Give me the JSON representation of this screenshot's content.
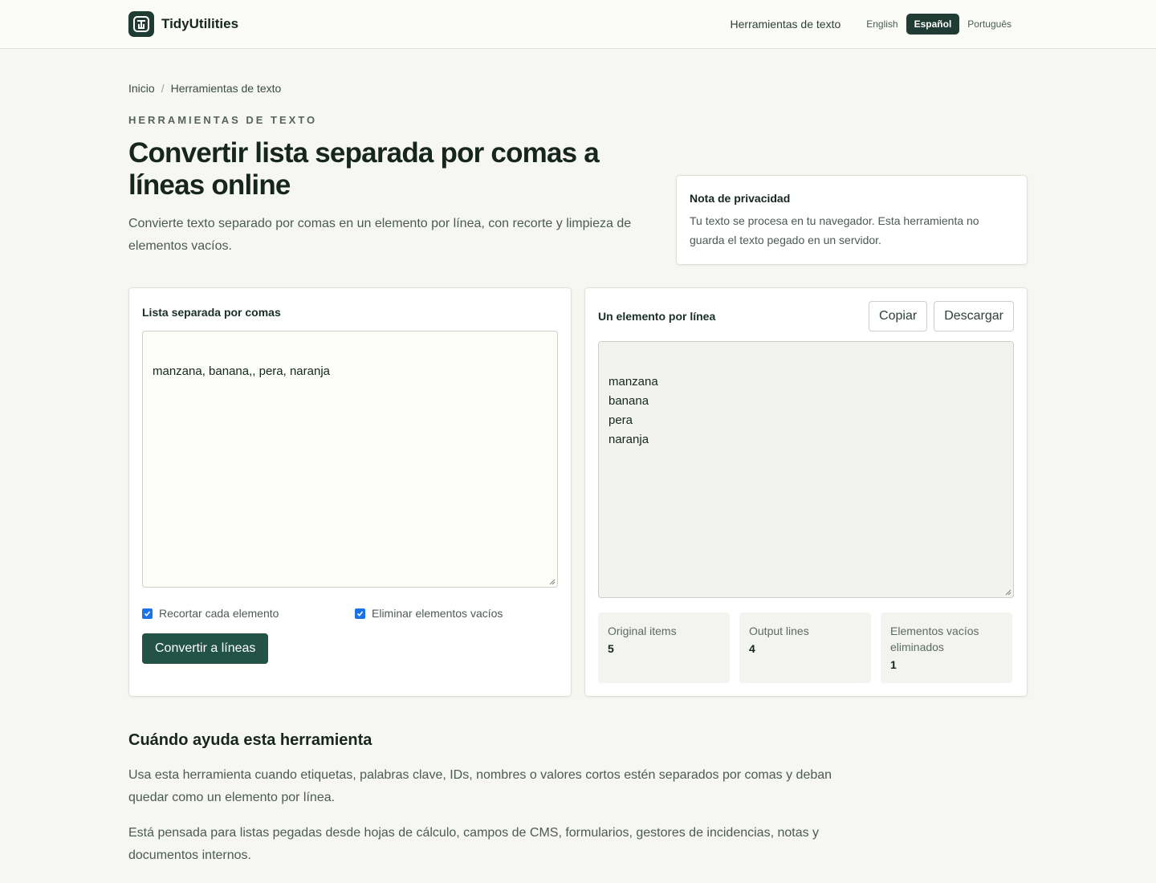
{
  "header": {
    "brand": "TidyUtilities",
    "nav_link": "Herramientas de texto",
    "languages": [
      {
        "label": "English",
        "active": false
      },
      {
        "label": "Español",
        "active": true
      },
      {
        "label": "Português",
        "active": false
      }
    ]
  },
  "breadcrumb": {
    "home": "Inicio",
    "separator": "/",
    "current": "Herramientas de texto"
  },
  "hero": {
    "eyebrow": "HERRAMIENTAS DE TEXTO",
    "title": "Convertir lista separada por comas a líneas online",
    "lead": "Convierte texto separado por comas en un elemento por línea, con recorte y limpieza de elementos vacíos."
  },
  "privacy": {
    "title": "Nota de privacidad",
    "text": "Tu texto se procesa en tu navegador. Esta herramienta no guarda el texto pegado en un servidor."
  },
  "input_panel": {
    "label": "Lista separada por comas",
    "value": "manzana, banana,, pera, naranja",
    "options": [
      {
        "label": "Recortar cada elemento",
        "checked": true
      },
      {
        "label": "Eliminar elementos vacíos",
        "checked": true
      }
    ],
    "convert_label": "Convertir a líneas"
  },
  "output_panel": {
    "label": "Un elemento por línea",
    "copy_label": "Copiar",
    "download_label": "Descargar",
    "value": "manzana\nbanana\npera\nnaranja",
    "stats": [
      {
        "label": "Original items",
        "value": "5"
      },
      {
        "label": "Output lines",
        "value": "4"
      },
      {
        "label": "Elementos vacíos eliminados",
        "value": "1"
      }
    ]
  },
  "info": {
    "heading": "Cuándo ayuda esta herramienta",
    "paragraphs": [
      "Usa esta herramienta cuando etiquetas, palabras clave, IDs, nombres o valores cortos estén separados por comas y deban quedar como un elemento por línea.",
      "Está pensada para listas pegadas desde hojas de cálculo, campos de CMS, formularios, gestores de incidencias, notas y documentos internos."
    ]
  },
  "colors": {
    "brand_dark": "#1f3b33",
    "primary_button": "#235347",
    "checkbox": "#1a73e8",
    "background": "#f6f6f3"
  },
  "icons": [
    "logo-icon",
    "checkbox-checked-icon",
    "resize-handle-icon"
  ]
}
